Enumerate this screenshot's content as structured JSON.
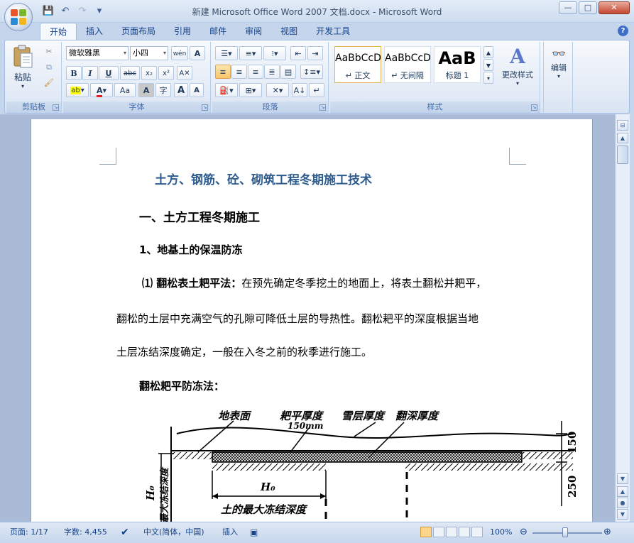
{
  "window": {
    "title": "新建 Microsoft Office Word 2007 文档.docx - Microsoft Word",
    "controls": [
      "—",
      "□",
      "✕"
    ]
  },
  "qat": {
    "save_icon": "💾",
    "undo_icon": "↶",
    "redo_icon": "↷",
    "more_icon": "▾"
  },
  "tabs": [
    {
      "label": "开始",
      "active": true
    },
    {
      "label": "插入"
    },
    {
      "label": "页面布局"
    },
    {
      "label": "引用"
    },
    {
      "label": "邮件"
    },
    {
      "label": "审阅"
    },
    {
      "label": "视图"
    },
    {
      "label": "开发工具"
    }
  ],
  "ribbon": {
    "clipboard": {
      "label": "剪贴板",
      "paste": "粘贴"
    },
    "font": {
      "label": "字体",
      "font_name": "微软雅黑",
      "font_size": "小四",
      "bold": "B",
      "italic": "I",
      "underline": "U",
      "strike": "abc",
      "subscript": "x₂",
      "superscript": "x²",
      "highlight": "ab",
      "font_color": "A",
      "case": "Aa",
      "grow": "A",
      "shrink": "A",
      "char_shading": "A",
      "enclose": "字",
      "wen": "wén",
      "border_char": "A"
    },
    "paragraph": {
      "label": "段落"
    },
    "styles": {
      "label": "样式",
      "items": [
        {
          "sample": "AaBbCcD",
          "name": "↵ 正文"
        },
        {
          "sample": "AaBbCcD",
          "name": "↵ 无间隔"
        },
        {
          "sample": "AaB",
          "name": "标题 1"
        }
      ],
      "change_styles": "更改样式"
    },
    "editing": {
      "label": "编辑"
    }
  },
  "document": {
    "title": "土方、钢筋、砼、砌筑工程冬期施工技术",
    "heading1": "一、土方工程冬期施工",
    "heading2": "1、地基土的保温防冻",
    "p1_lead": "⑴ 翻松表土耙平法：",
    "p1_text": "在预先确定冬季挖土的地面上，将表土翻松并耙平，",
    "p2": "翻松的土层中充满空气的孔隙可降低土层的导热性。翻松耙平的深度根据当地",
    "p3": "土层冻结深度确定，一般在入冬之前的秋季进行施工。",
    "heading3": "翻松耙平防冻法：",
    "diagram": {
      "label_surface": "地表面",
      "label_rake": "耙平厚度",
      "label_150mm": "150mm",
      "label_snow": "雪层厚度",
      "label_turn": "翻深厚度",
      "label_150": "150",
      "label_250": "250",
      "label_h0": "H₀",
      "label_h0_left": "H₀",
      "label_max_depth": "土的最大冻结深度",
      "label_vertical": "最大冻结深度"
    }
  },
  "statusbar": {
    "page": "页面: 1/17",
    "words": "字数: 4,455",
    "language": "中文(简体，中国)",
    "mode": "插入",
    "zoom": "100%"
  }
}
